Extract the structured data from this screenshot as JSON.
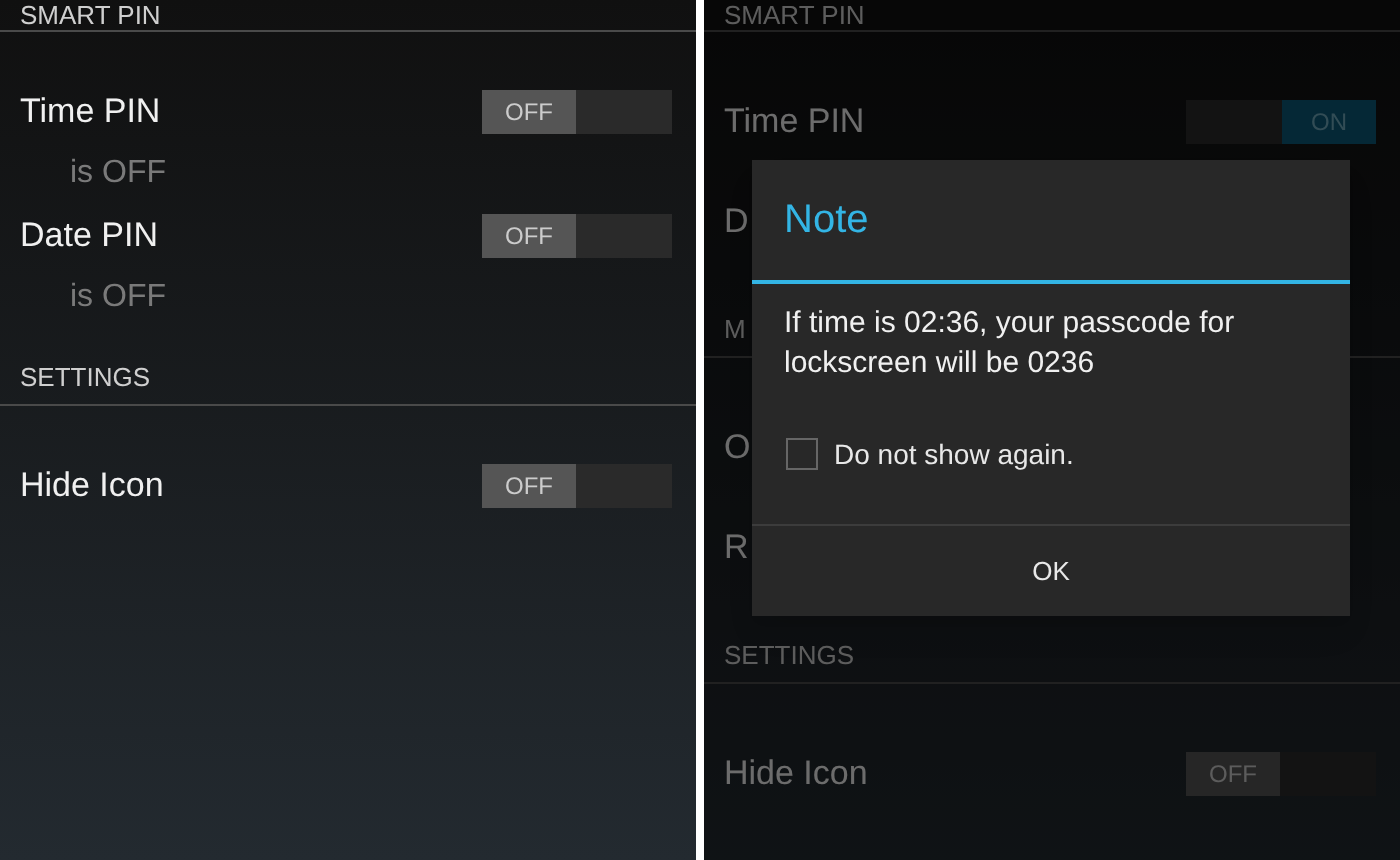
{
  "screens": [
    {
      "dimmed": false,
      "sections": [
        {
          "title": "SMART PIN",
          "rows": [
            {
              "label": "Time PIN",
              "on": false,
              "toggle_text": "OFF",
              "summary": "is OFF"
            },
            {
              "label": "Date PIN",
              "on": false,
              "toggle_text": "OFF",
              "summary": "is OFF"
            }
          ]
        },
        {
          "title": "SETTINGS",
          "rows": [
            {
              "label": "Hide Icon",
              "on": false,
              "toggle_text": "OFF"
            }
          ]
        }
      ]
    },
    {
      "dimmed": true,
      "sections": [
        {
          "title": "SMART PIN",
          "rows": [
            {
              "label": "Time PIN",
              "on": true,
              "toggle_text": "ON"
            },
            {
              "label": "D"
            }
          ]
        },
        {
          "title": "M",
          "rows": [
            {
              "label": "O"
            },
            {
              "label": "R"
            }
          ]
        },
        {
          "title": "SETTINGS",
          "rows": [
            {
              "label": "Hide Icon",
              "on": false,
              "toggle_text": "OFF"
            }
          ]
        }
      ],
      "dialog": {
        "title": "Note",
        "message": "If time is 02:36, your passcode for lockscreen will be 0236",
        "checkbox": {
          "label": "Do not show again.",
          "checked": false
        },
        "button": "OK"
      }
    }
  ]
}
